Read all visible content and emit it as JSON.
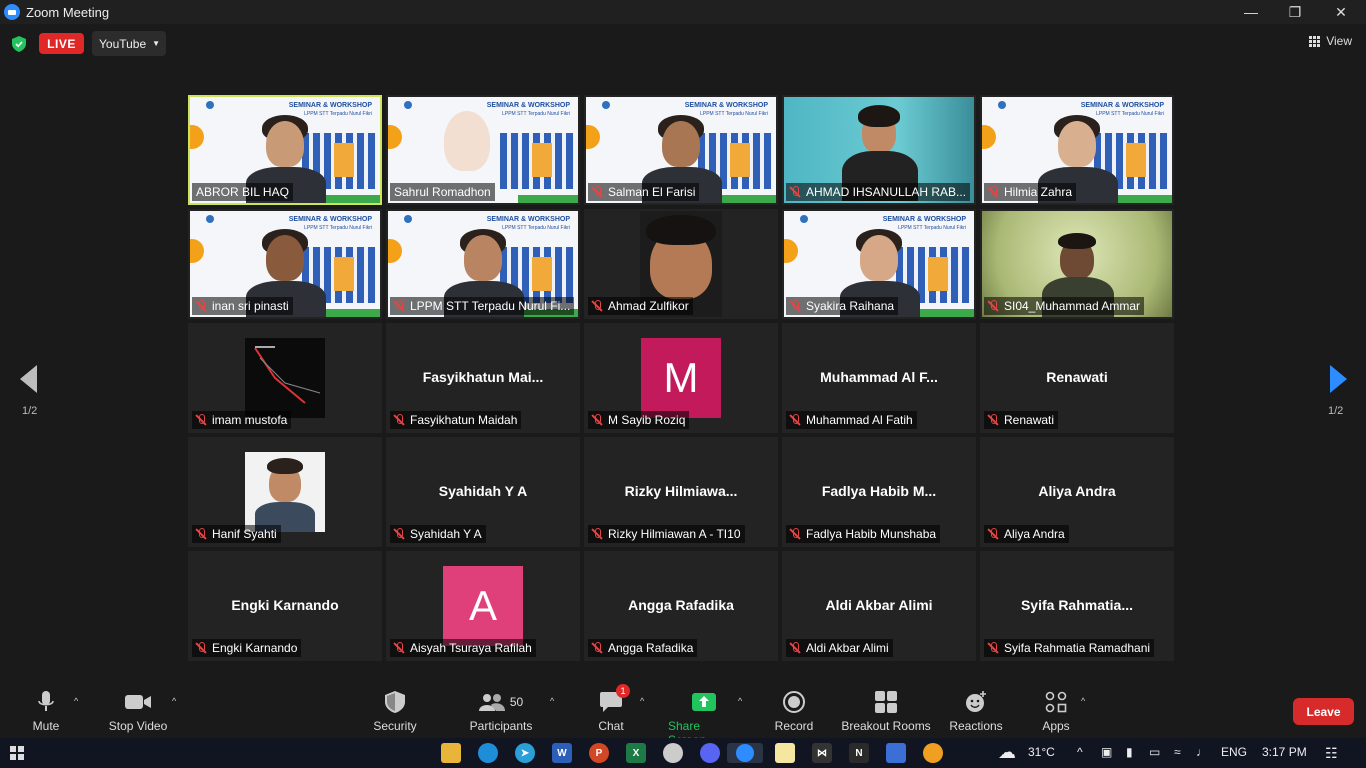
{
  "window": {
    "title": "Zoom Meeting"
  },
  "topbar": {
    "live_label": "LIVE",
    "stream_target": "YouTube",
    "view_label": "View"
  },
  "navigation": {
    "page_left": "1/2",
    "page_right": "1/2"
  },
  "participants_grid": [
    {
      "name": "ABROR BIL HAQ",
      "kind": "video",
      "muted": false,
      "active_speaker": true
    },
    {
      "name": "Sahrul Romadhon",
      "kind": "video",
      "muted": false
    },
    {
      "name": "Salman El Farisi",
      "kind": "video",
      "muted": true
    },
    {
      "name": "AHMAD IHSANULLAH RAB...",
      "kind": "video-room",
      "muted": true
    },
    {
      "name": "Hilmia Zahra",
      "kind": "video",
      "muted": true
    },
    {
      "name": "inan sri pinasti",
      "kind": "video",
      "muted": true
    },
    {
      "name": "LPPM STT Terpadu Nurul Fi...",
      "kind": "video",
      "muted": true
    },
    {
      "name": "Ahmad Zulfikor",
      "kind": "video-dark",
      "muted": true
    },
    {
      "name": "Syakira Raihana",
      "kind": "video",
      "muted": true
    },
    {
      "name": "SI04_Muhammad Ammar",
      "kind": "video-green",
      "muted": true
    },
    {
      "name": "imam mustofa",
      "kind": "thumb-chart",
      "muted": true
    },
    {
      "name": "Fasyikhatun Maidah",
      "display": "Fasyikhatun  Mai...",
      "kind": "name",
      "muted": true
    },
    {
      "name": "M Sayib Roziq",
      "kind": "avatar",
      "initial": "M",
      "avatar_color": "#c21a5a",
      "muted": true
    },
    {
      "name": "Muhammad Al Fatih",
      "display": "Muhammad  Al  F...",
      "kind": "name",
      "muted": true
    },
    {
      "name": "Renawati",
      "display": "Renawati",
      "kind": "name",
      "muted": true
    },
    {
      "name": "Hanif Syahti",
      "kind": "thumb-photo",
      "muted": true
    },
    {
      "name": "Syahidah Y A",
      "display": "Syahidah Y A",
      "kind": "name",
      "muted": true
    },
    {
      "name": "Rizky Hilmiawan A - TI10",
      "display": "Rizky  Hilmiawa...",
      "kind": "name",
      "muted": true
    },
    {
      "name": "Fadlya Habib Munshaba",
      "display": "Fadlya  Habib  M...",
      "kind": "name",
      "muted": true
    },
    {
      "name": "Aliya Andra",
      "display": "Aliya Andra",
      "kind": "name",
      "muted": true
    },
    {
      "name": "Engki Karnando",
      "display": "Engki Karnando",
      "kind": "name",
      "muted": true
    },
    {
      "name": "Aisyah Tsuraya Rafilah",
      "kind": "avatar",
      "initial": "A",
      "avatar_color": "#e0407a",
      "muted": true
    },
    {
      "name": "Angga Rafadika",
      "display": "Angga Rafadika",
      "kind": "name",
      "muted": true
    },
    {
      "name": "Aldi Akbar Alimi",
      "display": "Aldi Akbar Alimi",
      "kind": "name",
      "muted": true
    },
    {
      "name": "Syifa Rahmatia Ramadhani",
      "display": "Syifa  Rahmatia...",
      "kind": "name",
      "muted": true
    }
  ],
  "slide": {
    "line1": "SEMINAR & WORKSHOP",
    "line2": "LPPM STT Terpadu Nurul Fikri"
  },
  "toolbar": {
    "mute": "Mute",
    "stop_video": "Stop Video",
    "security": "Security",
    "participants": "Participants",
    "participants_count": "50",
    "chat": "Chat",
    "chat_badge": "1",
    "share_screen": "Share Screen",
    "record": "Record",
    "breakout_rooms": "Breakout Rooms",
    "reactions": "Reactions",
    "apps": "Apps",
    "leave": "Leave"
  },
  "taskbar": {
    "temperature": "31°C",
    "language": "ENG",
    "time": "3:17 PM"
  },
  "colors": {
    "live": "#e02828",
    "leave": "#d72b2b",
    "share_green": "#21c45d",
    "active_speaker_border": "#cde45a",
    "zoom_blue": "#2d8cff"
  }
}
